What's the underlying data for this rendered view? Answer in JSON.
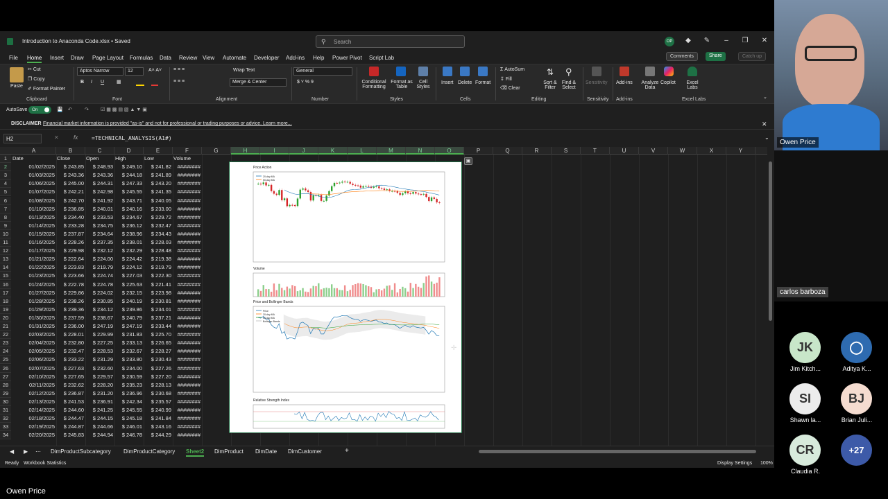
{
  "window": {
    "title": "Introduction to Anaconda Code.xlsx • Saved",
    "search_placeholder": "Search",
    "user_initials": "OP"
  },
  "menu": [
    "File",
    "Home",
    "Insert",
    "Draw",
    "Page Layout",
    "Formulas",
    "Data",
    "Review",
    "View",
    "Automate",
    "Developer",
    "Add-ins",
    "Help",
    "Power Pivot",
    "Script Lab"
  ],
  "menu_right": {
    "comments": "Comments",
    "share": "Share",
    "catchup": "Catch up"
  },
  "ribbon": {
    "clipboard": {
      "paste": "Paste",
      "cut": "Cut",
      "copy": "Copy",
      "format_painter": "Format Painter",
      "label": "Clipboard"
    },
    "font": {
      "name": "Aptos Narrow",
      "size": "12",
      "label": "Font"
    },
    "alignment": {
      "wrap": "Wrap Text",
      "merge": "Merge & Center",
      "label": "Alignment"
    },
    "number": {
      "format": "General",
      "label": "Number"
    },
    "styles": {
      "conditional": "Conditional Formatting",
      "format_table": "Format as Table",
      "cell_styles": "Cell Styles",
      "label": "Styles"
    },
    "cells": {
      "insert": "Insert",
      "delete": "Delete",
      "format": "Format",
      "label": "Cells"
    },
    "editing": {
      "autosum": "AutoSum",
      "fill": "Fill",
      "clear": "Clear",
      "sort": "Sort & Filter",
      "find": "Find & Select",
      "label": "Editing"
    },
    "sensitivity": {
      "btn": "Sensitivity",
      "label": "Sensitivity"
    },
    "addins": {
      "btn": "Add-ins",
      "label": "Add-ins"
    },
    "analyze": "Analyze Data",
    "copilot": "Copilot",
    "excel_labs": {
      "btn": "Excel Labs",
      "label": "Excel Labs"
    }
  },
  "qat": {
    "autosave": "AutoSave",
    "on": "On"
  },
  "disclaimer": {
    "title": "DISCLAIMER",
    "text": "Financial market information is provided \"as-is\" and not for professional or trading purposes or advice. Learn more..."
  },
  "formula_bar": {
    "cell": "H2",
    "fx": "fx",
    "formula": "=TECHNICAL_ANALYSIS(A1#)"
  },
  "columns": [
    "A",
    "B",
    "C",
    "D",
    "E",
    "F",
    "G",
    "H",
    "I",
    "J",
    "K",
    "L",
    "M",
    "N",
    "O",
    "P",
    "Q",
    "R",
    "S",
    "T",
    "U",
    "V",
    "W",
    "X",
    "Y"
  ],
  "headers": [
    "Date",
    "Close",
    "Open",
    "High",
    "Low",
    "Volume"
  ],
  "rows": [
    [
      "01/02/2025",
      "$ 243.85",
      "$ 248.93",
      "$ 249.10",
      "$ 241.82",
      "########"
    ],
    [
      "01/03/2025",
      "$ 243.36",
      "$ 243.36",
      "$ 244.18",
      "$ 241.89",
      "########"
    ],
    [
      "01/06/2025",
      "$ 245.00",
      "$ 244.31",
      "$ 247.33",
      "$ 243.20",
      "########"
    ],
    [
      "01/07/2025",
      "$ 242.21",
      "$ 242.98",
      "$ 245.55",
      "$ 241.35",
      "########"
    ],
    [
      "01/08/2025",
      "$ 242.70",
      "$ 241.92",
      "$ 243.71",
      "$ 240.05",
      "########"
    ],
    [
      "01/10/2025",
      "$ 236.85",
      "$ 240.01",
      "$ 240.16",
      "$ 233.00",
      "########"
    ],
    [
      "01/13/2025",
      "$ 234.40",
      "$ 233.53",
      "$ 234.67",
      "$ 229.72",
      "########"
    ],
    [
      "01/14/2025",
      "$ 233.28",
      "$ 234.75",
      "$ 236.12",
      "$ 232.47",
      "########"
    ],
    [
      "01/15/2025",
      "$ 237.87",
      "$ 234.64",
      "$ 238.96",
      "$ 234.43",
      "########"
    ],
    [
      "01/16/2025",
      "$ 228.26",
      "$ 237.35",
      "$ 238.01",
      "$ 228.03",
      "########"
    ],
    [
      "01/17/2025",
      "$ 229.98",
      "$ 232.12",
      "$ 232.29",
      "$ 228.48",
      "########"
    ],
    [
      "01/21/2025",
      "$ 222.64",
      "$ 224.00",
      "$ 224.42",
      "$ 219.38",
      "########"
    ],
    [
      "01/22/2025",
      "$ 223.83",
      "$ 219.79",
      "$ 224.12",
      "$ 219.79",
      "########"
    ],
    [
      "01/23/2025",
      "$ 223.66",
      "$ 224.74",
      "$ 227.03",
      "$ 222.30",
      "########"
    ],
    [
      "01/24/2025",
      "$ 222.78",
      "$ 224.78",
      "$ 225.63",
      "$ 221.41",
      "########"
    ],
    [
      "01/27/2025",
      "$ 229.86",
      "$ 224.02",
      "$ 232.15",
      "$ 223.98",
      "########"
    ],
    [
      "01/28/2025",
      "$ 238.26",
      "$ 230.85",
      "$ 240.19",
      "$ 230.81",
      "########"
    ],
    [
      "01/29/2025",
      "$ 239.36",
      "$ 234.12",
      "$ 239.86",
      "$ 234.01",
      "########"
    ],
    [
      "01/30/2025",
      "$ 237.59",
      "$ 238.67",
      "$ 240.79",
      "$ 237.21",
      "########"
    ],
    [
      "01/31/2025",
      "$ 236.00",
      "$ 247.19",
      "$ 247.19",
      "$ 233.44",
      "########"
    ],
    [
      "02/03/2025",
      "$ 228.01",
      "$ 229.99",
      "$ 231.83",
      "$ 225.70",
      "########"
    ],
    [
      "02/04/2025",
      "$ 232.80",
      "$ 227.25",
      "$ 233.13",
      "$ 226.65",
      "########"
    ],
    [
      "02/05/2025",
      "$ 232.47",
      "$ 228.53",
      "$ 232.67",
      "$ 228.27",
      "########"
    ],
    [
      "02/06/2025",
      "$ 233.22",
      "$ 231.29",
      "$ 233.80",
      "$ 230.43",
      "########"
    ],
    [
      "02/07/2025",
      "$ 227.63",
      "$ 232.60",
      "$ 234.00",
      "$ 227.26",
      "########"
    ],
    [
      "02/10/2025",
      "$ 227.65",
      "$ 229.57",
      "$ 230.59",
      "$ 227.20",
      "########"
    ],
    [
      "02/11/2025",
      "$ 232.62",
      "$ 228.20",
      "$ 235.23",
      "$ 228.13",
      "########"
    ],
    [
      "02/12/2025",
      "$ 236.87",
      "$ 231.20",
      "$ 236.96",
      "$ 230.68",
      "########"
    ],
    [
      "02/13/2025",
      "$ 241.53",
      "$ 236.91",
      "$ 242.34",
      "$ 235.57",
      "########"
    ],
    [
      "02/14/2025",
      "$ 244.60",
      "$ 241.25",
      "$ 245.55",
      "$ 240.99",
      "########"
    ],
    [
      "02/18/2025",
      "$ 244.47",
      "$ 244.15",
      "$ 245.18",
      "$ 241.84",
      "########"
    ],
    [
      "02/19/2025",
      "$ 244.87",
      "$ 244.66",
      "$ 246.01",
      "$ 243.16",
      "########"
    ],
    [
      "02/20/2025",
      "$ 245.83",
      "$ 244.94",
      "$ 246.78",
      "$ 244.29",
      "########"
    ]
  ],
  "chart": {
    "panel1": "Price Action",
    "panel2": "Volume",
    "panel3": "Price and Bollinger Bands",
    "panel4": "Relative Strength Index",
    "legend1": [
      "20-day MA",
      "50-day MA"
    ],
    "legend3": [
      "Price",
      "20-day MA",
      "50-day MA",
      "Bollinger Bands"
    ]
  },
  "sheets": [
    "DimProductSubcategory",
    "DimProductCategory",
    "Sheet2",
    "DimProduct",
    "DimDate",
    "DimCustomer"
  ],
  "active_sheet": "Sheet2",
  "status": {
    "ready": "Ready",
    "stats": "Workbook Statistics",
    "display": "Display Settings",
    "zoom": "100%"
  },
  "bottom_name": "Owen Price",
  "video": {
    "speaker": "Owen Price",
    "second": "carlos barboza",
    "participants": [
      {
        "initials": "JK",
        "name": "Jim Kitch...",
        "color": "#c8e6c9"
      },
      {
        "initials": "",
        "name": "Aditya K...",
        "color": "#2e6bb0"
      },
      {
        "initials": "SI",
        "name": "Shawn la...",
        "color": "#ececec"
      },
      {
        "initials": "BJ",
        "name": "Brian Juli...",
        "color": "#f5dcd0"
      },
      {
        "initials": "CR",
        "name": "Claudia R.",
        "color": "#d7eadb"
      },
      {
        "initials": "+27",
        "name": "",
        "color": "#3d5aa8"
      }
    ]
  }
}
